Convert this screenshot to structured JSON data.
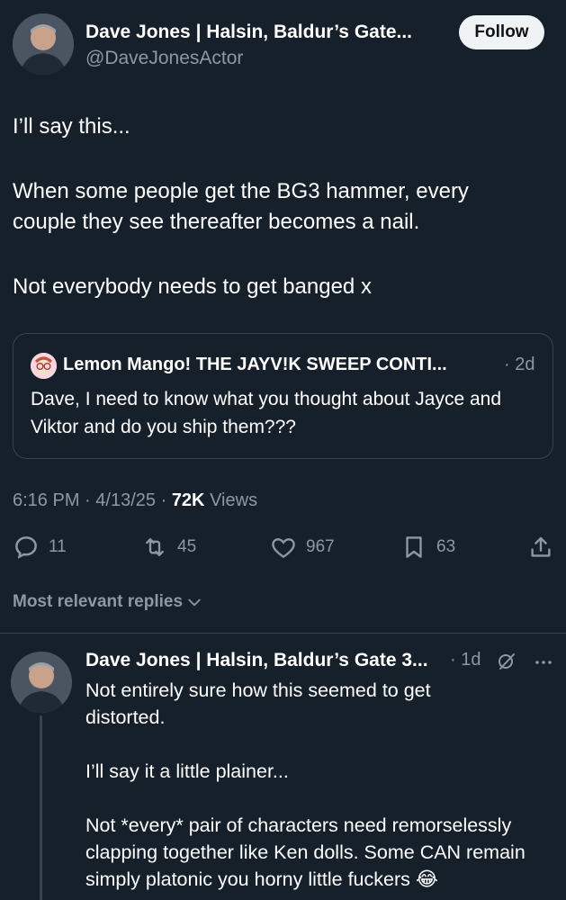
{
  "post": {
    "author_name": "Dave Jones | Halsin, Baldur’s Gate...",
    "author_handle": "@DaveJonesActor",
    "follow_label": "Follow",
    "paragraphs": [
      "I’ll say this...",
      "When some people get the BG3 hammer, every couple they see thereafter becomes a nail.",
      "Not everybody needs to get banged x"
    ],
    "time": "6:16 PM",
    "date": "4/13/25",
    "views_count": "72K",
    "views_label": "Views",
    "separator": "·"
  },
  "quote": {
    "author_name": "Lemon Mango! THE JAYV!K SWEEP CONTI...",
    "time": "· 2d",
    "text": "Dave, I need to know what you thought about Jayce and Viktor and do you ship them???"
  },
  "actions": {
    "replies": "11",
    "reposts": "45",
    "likes": "967",
    "bookmarks": "63"
  },
  "replies_filter": {
    "label": "Most relevant replies"
  },
  "reply": {
    "author_name": "Dave Jones | Halsin, Baldur’s Gate 3...",
    "time": "· 1d",
    "paragraphs": [
      "Not entirely sure how this seemed to get distorted.",
      "I’ll say it a little plainer...",
      "Not *every* pair of characters need remorselessly clapping together like Ken dolls. Some CAN remain simply platonic you horny little fuckers 😂"
    ]
  },
  "colors": {
    "background": "#15202b",
    "secondary_text": "#8b98a5",
    "border": "#38444d"
  }
}
